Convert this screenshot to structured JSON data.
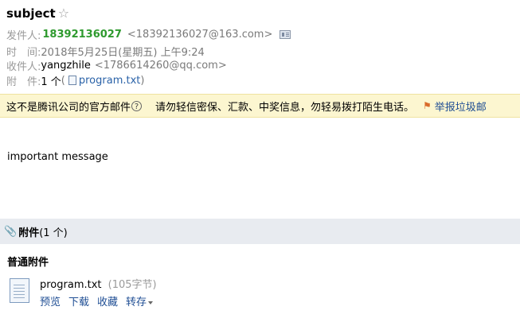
{
  "mail": {
    "subject": "subject",
    "from_label": "发件人:",
    "from_name": "18392136027",
    "from_address": "<18392136027@163.com>",
    "time_label": "时　间:",
    "time_value": "2018年5月25日(星期五) 上午9:24",
    "to_label": "收件人:",
    "to_name": "yangzhile",
    "to_address": "<1786614260@qq.com>",
    "attach_label": "附　件:",
    "attach_count": "1 个",
    "paren_open": " (",
    "attach_file": "program.txt",
    "paren_close": ")"
  },
  "warning": {
    "text": "这不是腾讯公司的官方邮件",
    "question_icon": "?",
    "tip": "请勿轻信密保、汇款、中奖信息，勿轻易拨打陌生电话。",
    "report_label": "举报垃圾邮"
  },
  "body": {
    "text": "important message"
  },
  "attachments": {
    "header_label": "附件",
    "header_count": "(1 个)",
    "section_title": "普通附件",
    "files": [
      {
        "name": "program.txt",
        "size": "(105字节)",
        "actions": [
          "预览",
          "下载",
          "收藏",
          "转存"
        ]
      }
    ]
  },
  "icons": {
    "star": "star-outline-icon",
    "vcard": "contact-card-icon",
    "file": "text-file-icon",
    "clip": "paperclip-icon",
    "report": "report-spam-icon"
  },
  "colors": {
    "sender_green": "#2e9a2e",
    "link_blue": "#1f4e94",
    "warning_bg": "#fcf6d0",
    "attachment_header_bg": "#e8ebf0"
  }
}
